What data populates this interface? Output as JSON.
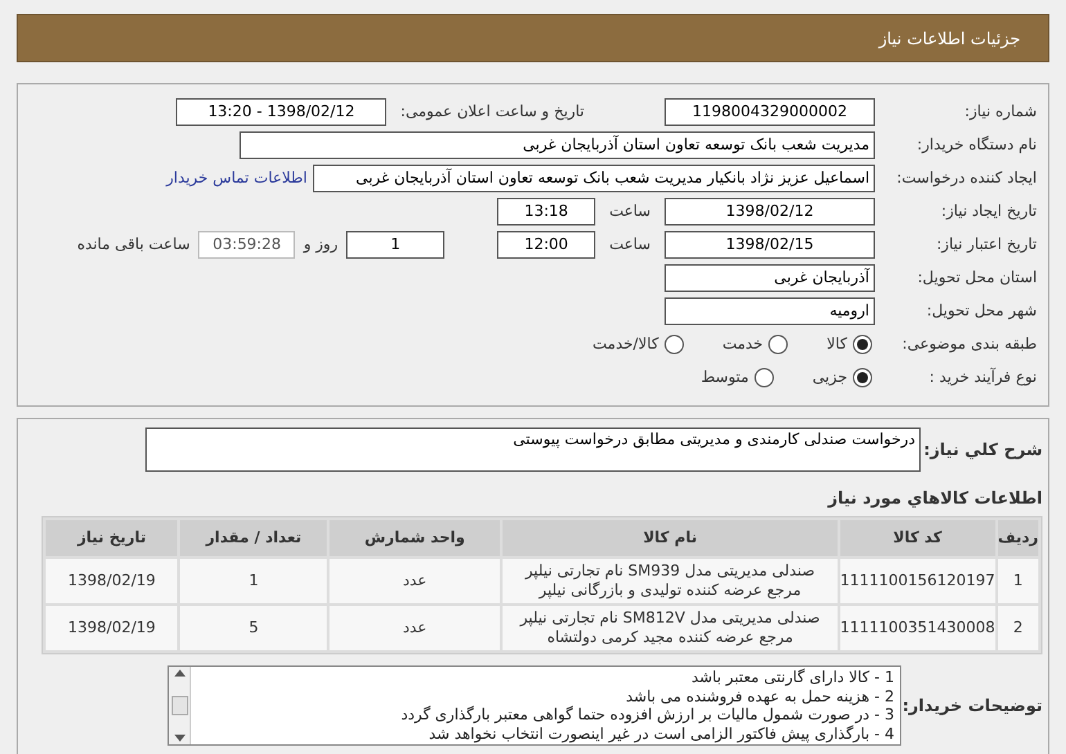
{
  "header": {
    "title": "جزئیات اطلاعات نیاز"
  },
  "form": {
    "need_number": {
      "label": "شماره نیاز:",
      "value": "1198004329000002"
    },
    "announce": {
      "label": "تاریخ و ساعت اعلان عمومی:",
      "value": "1398/02/12 - 13:20"
    },
    "buyer_org": {
      "label": "نام دستگاه خریدار:",
      "value": "مدیریت شعب بانک توسعه تعاون استان آذربایجان غربی"
    },
    "requester": {
      "label": "ایجاد کننده درخواست:",
      "value": "اسماعیل عزیز نژاد بانکیار مدیریت شعب بانک توسعه تعاون استان آذربایجان غربی",
      "link": "اطلاعات تماس خریدار"
    },
    "created": {
      "label": "تاریخ ایجاد نیاز:",
      "date": "1398/02/12",
      "time_label": "ساعت",
      "time": "13:18"
    },
    "validity": {
      "label": "تاریخ اعتبار نیاز:",
      "date": "1398/02/15",
      "time_label": "ساعت",
      "time": "12:00",
      "days": "1",
      "days_label": "روز و",
      "remaining": "03:59:28",
      "remaining_label": "ساعت باقی مانده"
    },
    "province": {
      "label": "استان محل تحویل:",
      "value": "آذربایجان غربی"
    },
    "city": {
      "label": "شهر محل تحویل:",
      "value": "ارومیه"
    },
    "category": {
      "label": "طبقه بندی موضوعی:",
      "options": [
        {
          "label": "کالا",
          "selected": true
        },
        {
          "label": "خدمت",
          "selected": false
        },
        {
          "label": "کالا/خدمت",
          "selected": false
        }
      ]
    },
    "process": {
      "label": "نوع فرآیند خرید :",
      "options": [
        {
          "label": "جزیی",
          "selected": true
        },
        {
          "label": "متوسط",
          "selected": false
        }
      ]
    }
  },
  "description": {
    "label": "شرح کلي نیاز:",
    "value": "درخواست صندلی کارمندی و مدیریتی مطابق درخواست پیوستی"
  },
  "goods": {
    "title": "اطلاعات کالاهاي مورد نیاز",
    "columns": [
      "ردیف",
      "کد کالا",
      "نام کالا",
      "واحد شمارش",
      "تعداد / مقدار",
      "تاریخ نیاز"
    ],
    "rows": [
      [
        "1",
        "1111100156120197",
        "صندلی مدیریتی مدل SM939 نام تجارتی نیلپر مرجع عرضه کننده تولیدی و بازرگانی نیلپر",
        "عدد",
        "1",
        "1398/02/19"
      ],
      [
        "2",
        "1111100351430008",
        "صندلی مدیریتی مدل SM812V نام تجارتی نیلپر مرجع عرضه کننده مجید کرمی دولتشاه",
        "عدد",
        "5",
        "1398/02/19"
      ]
    ]
  },
  "notes": {
    "label": "توضیحات خریدار:",
    "lines": [
      "1 - کالا دارای گارنتی معتبر باشد",
      "2 - هزینه حمل به عهده فروشنده می باشد",
      "3 - در صورت شمول مالیات بر ارزش افزوده حتما گواهی معتبر بارگذاری گردد",
      "4 - بارگذاری پیش فاکتور الزامی است در غیر اینصورت انتخاب نخواهد شد"
    ]
  }
}
